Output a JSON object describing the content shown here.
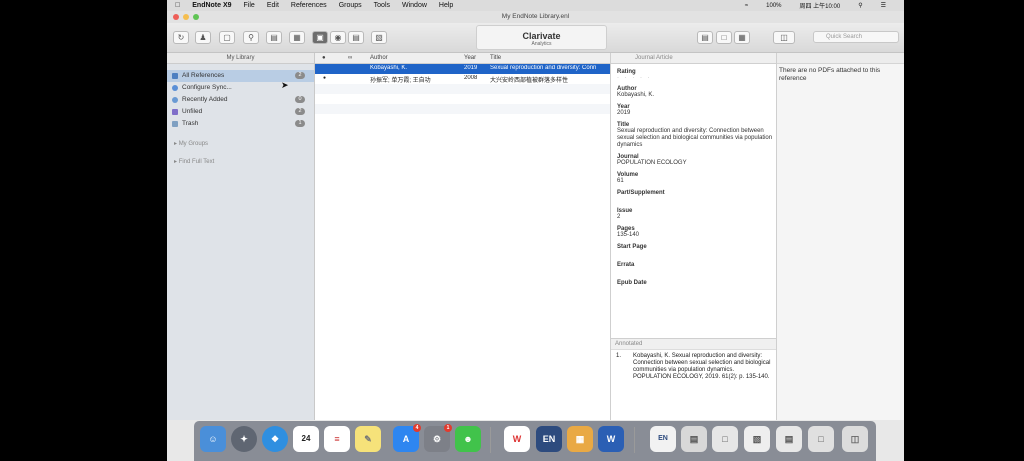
{
  "menubar": {
    "apple": "",
    "app": "EndNote X9",
    "items": [
      "File",
      "Edit",
      "References",
      "Groups",
      "Tools",
      "Window",
      "Help"
    ],
    "battery": "100%",
    "clock": "周四 上午10:00"
  },
  "window": {
    "title": "My EndNote Library.enl"
  },
  "toolbar": {
    "brand_name": "Clarivate",
    "brand_sub": "Analytics",
    "search_placeholder": "Quick Search"
  },
  "sidebar": {
    "header": "My Library",
    "groups": [
      {
        "label": "All References",
        "count": "2",
        "selected": true
      },
      {
        "label": "Configure Sync...",
        "count": ""
      },
      {
        "label": "Recently Added",
        "count": "0"
      },
      {
        "label": "Unfiled",
        "count": "2"
      },
      {
        "label": "Trash",
        "count": "1"
      }
    ],
    "sections": [
      "My Groups",
      "Find Full Text"
    ]
  },
  "list": {
    "columns": {
      "author": "Author",
      "year": "Year",
      "title": "Title"
    },
    "rows": [
      {
        "author": "Kobayashi, K.",
        "year": "2019",
        "title": "Sexual reproduction and diversity: Conn",
        "selected": true
      },
      {
        "author": "孙振军; 单万霞; 王自功",
        "year": "2008",
        "title": "大兴安岭西部植被群落多样性",
        "selected": false
      }
    ]
  },
  "detail": {
    "ref_type": "Journal Article",
    "fields": [
      {
        "label": "Rating",
        "value": "· · · · ·"
      },
      {
        "label": "Author",
        "value": "Kobayashi, K."
      },
      {
        "label": "Year",
        "value": "2019"
      },
      {
        "label": "Title",
        "value": "Sexual reproduction and diversity: Connection between sexual selection and biological communities via population dynamics"
      },
      {
        "label": "Journal",
        "value": "POPULATION ECOLOGY"
      },
      {
        "label": "Volume",
        "value": "61"
      },
      {
        "label": "Part/Supplement",
        "value": ""
      },
      {
        "label": "Issue",
        "value": "2"
      },
      {
        "label": "Pages",
        "value": "135-140"
      },
      {
        "label": "Start Page",
        "value": ""
      },
      {
        "label": "Errata",
        "value": ""
      },
      {
        "label": "Epub Date",
        "value": ""
      }
    ]
  },
  "preview": {
    "style": "Annotated",
    "num": "1.",
    "text": "Kobayashi, K. Sexual reproduction and diversity: Connection between sexual selection and biological communities via population dynamics. POPULATION ECOLOGY, 2019. 61(2): p. 135-140."
  },
  "pdf": {
    "message": "There are no PDFs attached to this reference"
  },
  "dock": {
    "calendar_day": "24",
    "appstore_badge": "4",
    "settings_badge": "1",
    "endnote_label": "EN"
  }
}
